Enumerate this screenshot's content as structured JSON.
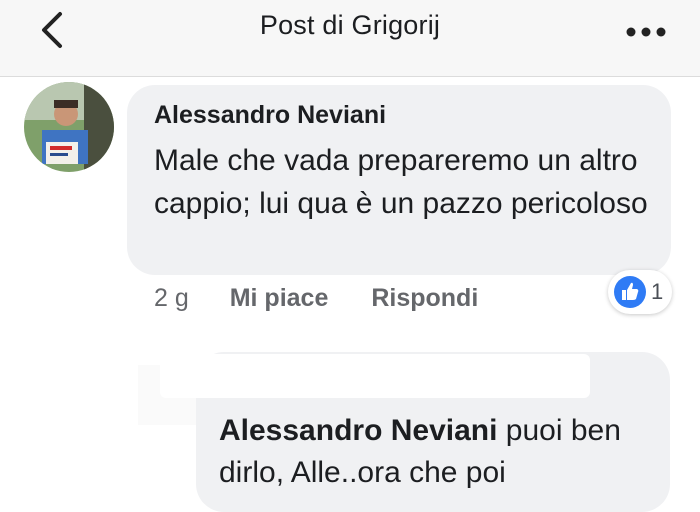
{
  "header": {
    "back_icon": "chevron-left-icon",
    "title": "Post di Grigorij",
    "more_icon": "ellipsis-icon"
  },
  "comment": {
    "author": "Alessandro Neviani",
    "text": "Male che vada prepareremo un altro cappio; lui qua è un pazzo pericoloso",
    "age": "2 g",
    "like_label": "Mi piace",
    "reply_label": "Rispondi",
    "reaction_icon": "thumbs-up-icon",
    "reaction_count": "1",
    "avatar_icon": "profile-photo"
  },
  "reply": {
    "mention": "Alessandro Neviani",
    "text": " puoi ben dirlo, Alle..ora che poi"
  },
  "colors": {
    "accent": "#2f7bf5",
    "bubble": "#f0f1f3",
    "muted_text": "#65676b"
  }
}
